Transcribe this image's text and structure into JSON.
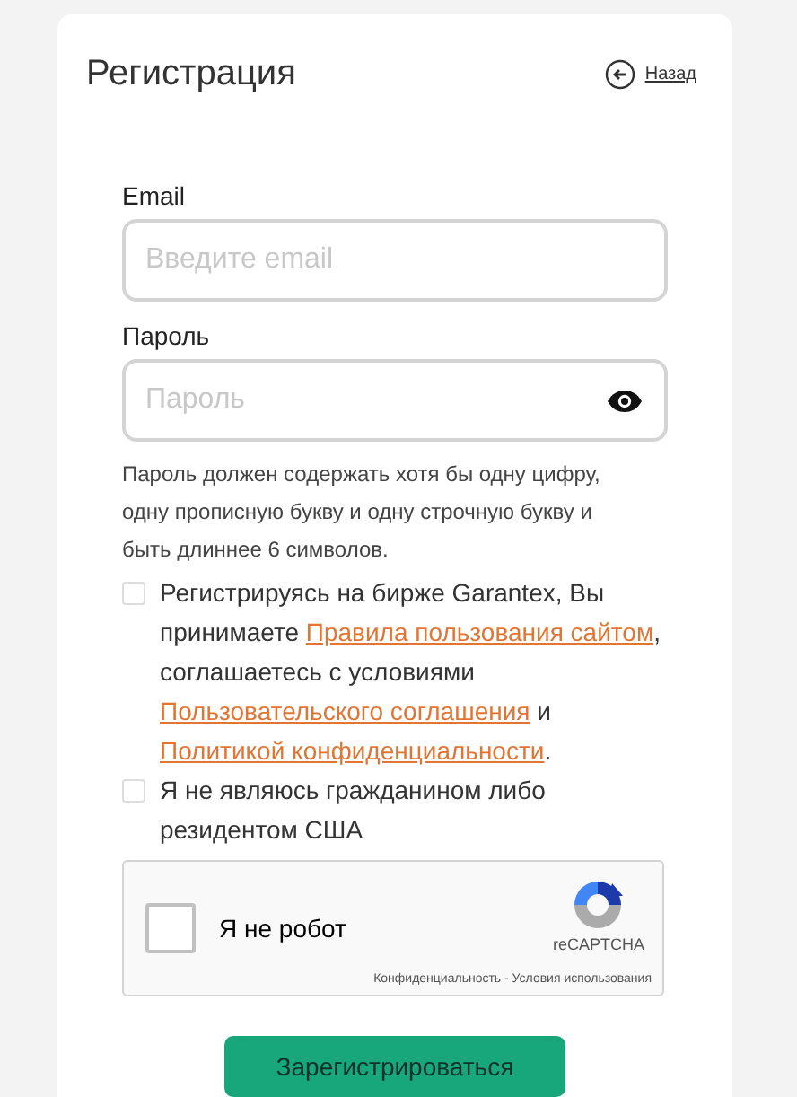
{
  "title": "Регистрация",
  "back_link": "Назад",
  "email": {
    "label": "Email",
    "placeholder": "Введите email"
  },
  "password": {
    "label": "Пароль",
    "placeholder": "Пароль",
    "hint": "Пароль должен содержать хотя бы одну цифру, одну прописную букву и одну строчную букву и быть длиннее 6 символов."
  },
  "agreements": [
    {
      "checked": false,
      "parts": [
        {
          "kind": "text",
          "text": "Регистрируясь на бирже Garantex, Вы принимаете "
        },
        {
          "kind": "link",
          "text": "Правила пользования сайтом"
        },
        {
          "kind": "text",
          "text": ", соглашаетесь с условиями "
        },
        {
          "kind": "link",
          "text": "Пользовательского соглашения"
        },
        {
          "kind": "text",
          "text": " и "
        },
        {
          "kind": "link",
          "text": "Политикой конфиденциальности"
        },
        {
          "kind": "text",
          "text": "."
        }
      ]
    },
    {
      "checked": false,
      "parts": [
        {
          "kind": "text",
          "text": "Я не являюсь гражданином либо резидентом США"
        }
      ]
    }
  ],
  "captcha": {
    "checked": false,
    "label": "Я не робот",
    "brand": "reCAPTCHA",
    "footer": "Конфиденциальность - Условия использования"
  },
  "submit": "Зарегистрироваться"
}
